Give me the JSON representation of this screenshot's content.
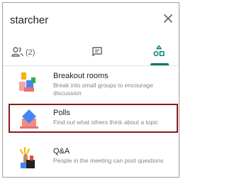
{
  "header": {
    "title": "starcher",
    "close_icon": "close-icon"
  },
  "tabs": [
    {
      "name": "people",
      "icon": "people-icon",
      "count": "(2)"
    },
    {
      "name": "chat",
      "icon": "chat-icon"
    },
    {
      "name": "activities",
      "icon": "activities-icon",
      "selected": true
    }
  ],
  "activities": [
    {
      "title": "Breakout rooms",
      "description": "Break into small groups to encourage discussion",
      "icon": "breakout-rooms-icon"
    },
    {
      "title": "Polls",
      "description": "Find out what others think about a topic",
      "icon": "polls-icon",
      "highlighted": true
    },
    {
      "title": "Q&A",
      "description": "People in the meeting can post questions",
      "icon": "qa-icon"
    }
  ],
  "colors": {
    "accent": "#00796b",
    "highlight_border": "#8b1a1a",
    "text_primary": "#202124",
    "text_secondary": "#80868b"
  }
}
